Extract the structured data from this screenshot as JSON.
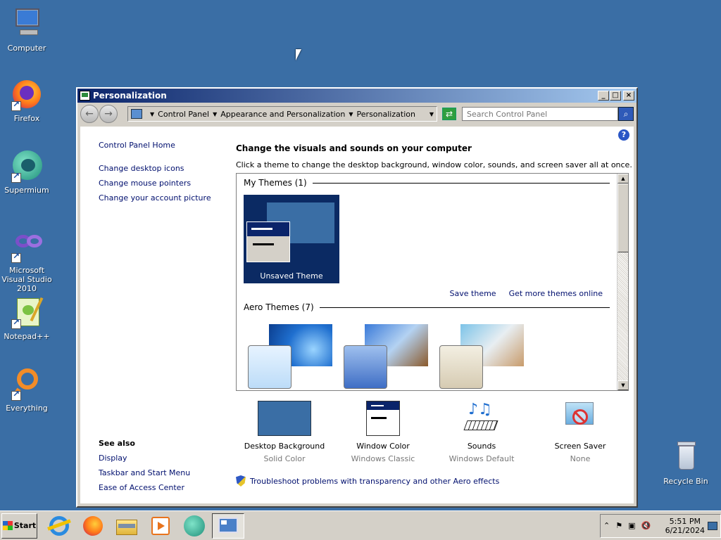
{
  "desktop": {
    "icons": [
      {
        "label": "Computer"
      },
      {
        "label": "Firefox"
      },
      {
        "label": "Supermium"
      },
      {
        "label": "Microsoft Visual Studio 2010"
      },
      {
        "label": "Notepad++"
      },
      {
        "label": "Everything"
      },
      {
        "label": "Recycle Bin"
      }
    ]
  },
  "window": {
    "title": "Personalization",
    "address": {
      "crumbs": [
        "Control Panel",
        "Appearance and Personalization",
        "Personalization"
      ]
    },
    "search": {
      "placeholder": "Search Control Panel"
    },
    "sidebar": {
      "home": "Control Panel Home",
      "links": [
        "Change desktop icons",
        "Change mouse pointers",
        "Change your account picture"
      ]
    },
    "see_also": {
      "header": "See also",
      "links": [
        "Display",
        "Taskbar and Start Menu",
        "Ease of Access Center"
      ]
    },
    "main": {
      "title": "Change the visuals and sounds on your computer",
      "description": "Click a theme to change the desktop background, window color, sounds, and screen saver all at once.",
      "my_themes_header": "My Themes (1)",
      "unsaved_theme": "Unsaved Theme",
      "save_theme": "Save theme",
      "get_more": "Get more themes online",
      "aero_header": "Aero Themes (7)"
    },
    "options": [
      {
        "label": "Desktop Background",
        "value": "Solid Color"
      },
      {
        "label": "Window Color",
        "value": "Windows Classic"
      },
      {
        "label": "Sounds",
        "value": "Windows Default"
      },
      {
        "label": "Screen Saver",
        "value": "None"
      }
    ],
    "troubleshoot": "Troubleshoot problems with transparency and other Aero effects"
  },
  "taskbar": {
    "start_label": "Start",
    "clock_time": "5:51 PM",
    "clock_date": "6/21/2024"
  },
  "colors": {
    "desktop": "#3a6ea5",
    "title_bar": "#0a246a",
    "link": "#000f6e"
  }
}
